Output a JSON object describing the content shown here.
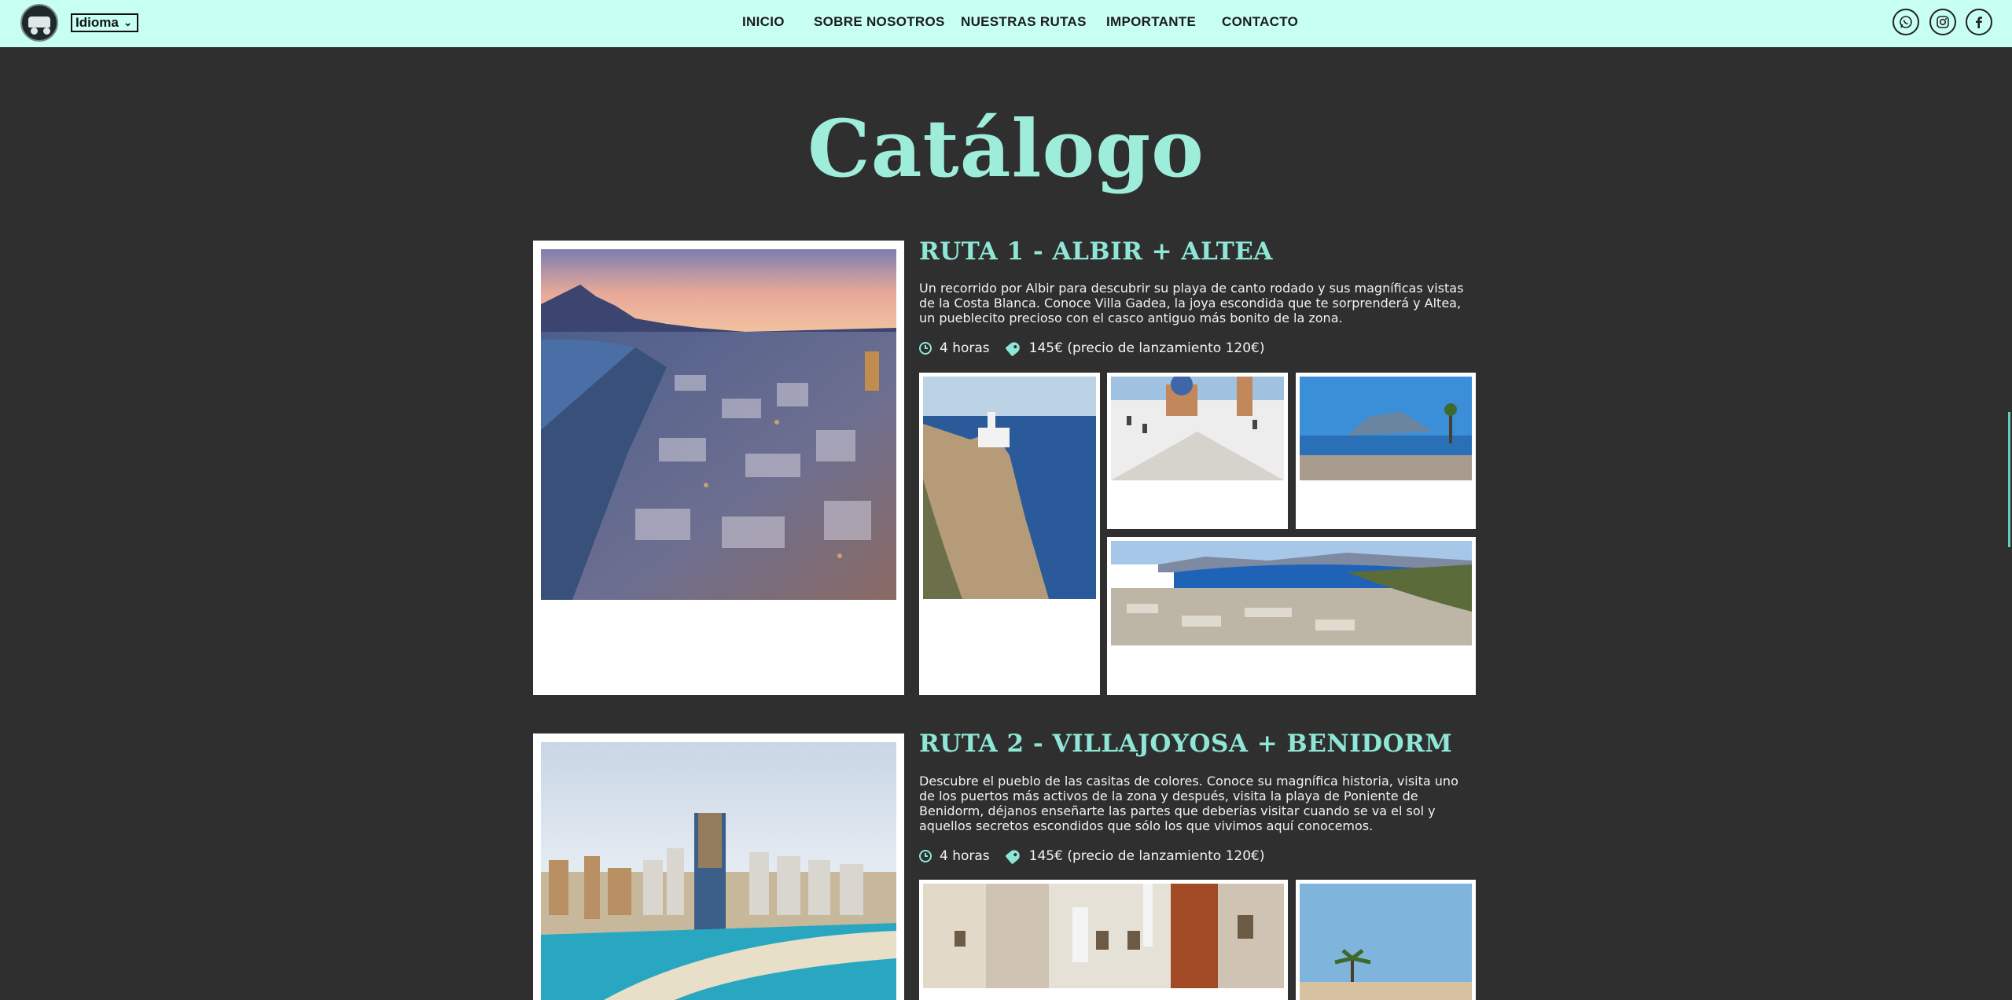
{
  "header": {
    "language_select": "Idioma",
    "nav": [
      "INICIO",
      "SOBRE NOSOTROS",
      "NUESTRAS RUTAS",
      "IMPORTANTE",
      "CONTACTO"
    ],
    "social_icons": [
      "whatsapp-icon",
      "instagram-icon",
      "facebook-icon"
    ]
  },
  "page": {
    "title": "Catálogo"
  },
  "routes": [
    {
      "title": "RUTA 1 - ALBIR + ALTEA",
      "description": "Un recorrido por Albir para descubrir su playa de canto rodado y sus magníficas vistas de la Costa Blanca. Conoce Villa Gadea, la joya escondida que te sorprenderá y Altea, un pueblecito precioso con el casco antiguo más bonito de la zona.",
      "duration": "4 horas",
      "price": "145€ (precio de lanzamiento 120€)"
    },
    {
      "title": "RUTA 2 - VILLAJOYOSA + BENIDORM",
      "description": "Descubre el pueblo de las casitas de colores. Conoce su magnífica historia, visita uno de los puertos más activos de la zona y después, visita la playa de Poniente de Benidorm, déjanos enseñarte las partes que deberías visitar cuando se va el sol y aquellos secretos escondidos que sólo los que vivimos aquí conocemos.",
      "duration": "4 horas",
      "price": "145€ (precio de lanzamiento 120€)"
    }
  ],
  "colors": {
    "header_bg": "#c8fff3",
    "page_bg": "#2f2f2f",
    "accent": "#8ee7d6"
  }
}
